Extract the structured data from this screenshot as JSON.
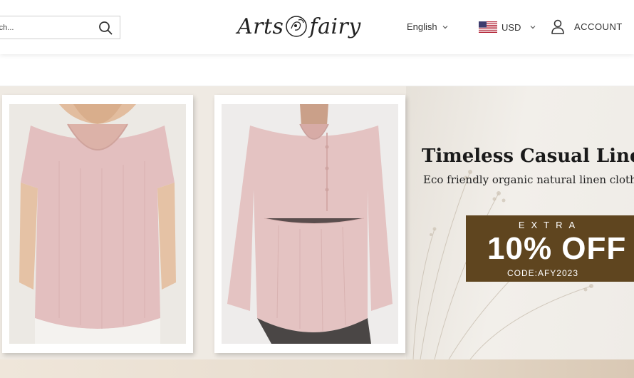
{
  "header": {
    "search": {
      "placeholder": "rch...",
      "value": ""
    },
    "logo": {
      "left": "Arts",
      "right": "fairy"
    },
    "language": {
      "label": "English"
    },
    "currency": {
      "label": "USD"
    },
    "account": {
      "label": "ACCOUNT"
    }
  },
  "banner": {
    "headline": "Timeless Casual Linen A",
    "subline": "Eco friendly organic natural linen clothin",
    "offer": {
      "extra": "EXTRA",
      "discount": "10% OFF",
      "code": "CODE:AFY2023"
    }
  },
  "colors": {
    "offer_bg": "#5f451f",
    "shirt_pink": "#e3bfbf"
  }
}
